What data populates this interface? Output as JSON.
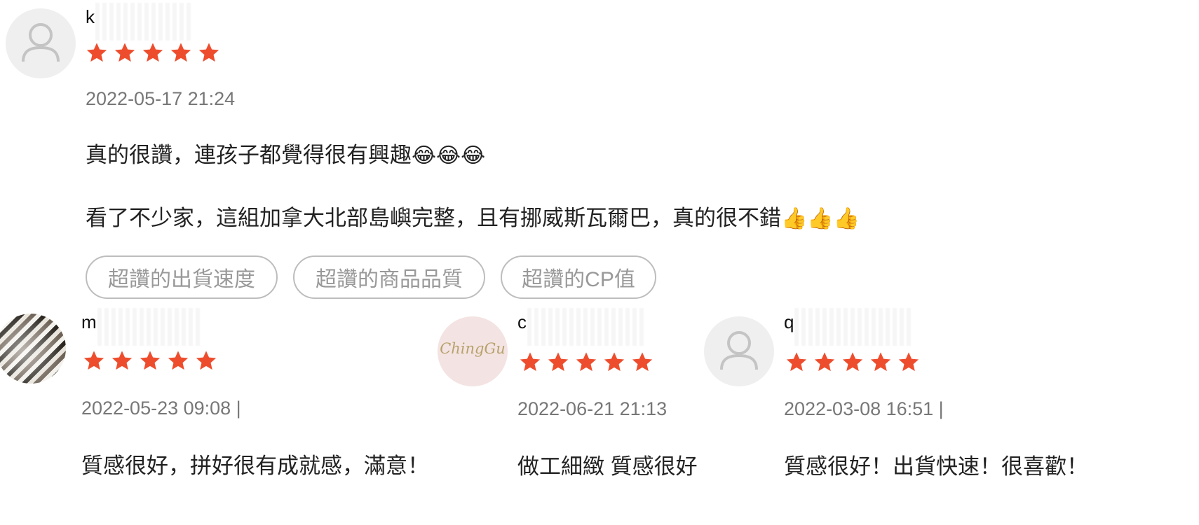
{
  "colors": {
    "star": "#EE4D2D",
    "timestamp": "#777777",
    "tag_border": "#BDBDBD",
    "tag_text": "#999999",
    "avatar_bg": "#EFEFEF"
  },
  "reviews": [
    {
      "username_visible": "k",
      "avatar_icon": "user-placeholder-icon",
      "rating": 5,
      "timestamp": "2022-05-17 21:24",
      "comment_line1": "真的很讚，連孩子都覺得很有興趣",
      "comment_line1_emoji": "😂😂😂",
      "comment_line2": "看了不少家，這組加拿大北部島嶼完整，且有挪威斯瓦爾巴，真的很不錯",
      "comment_line2_emoji": "👍👍👍",
      "tags": [
        "超讚的出貨速度",
        "超讚的商品品質",
        "超讚的CP值"
      ]
    },
    {
      "username_visible": "m",
      "avatar_icon": "user-photo-avatar",
      "rating": 5,
      "timestamp": "2022-05-23 09:08 |",
      "comment": "質感很好，拼好很有成就感，滿意！"
    },
    {
      "username_visible": "c",
      "avatar_icon": "brand-logo-avatar",
      "avatar_text": "ChingGu",
      "rating": 5,
      "timestamp": "2022-06-21 21:13",
      "comment": "做工細緻 質感很好"
    },
    {
      "username_visible": "q",
      "avatar_icon": "user-placeholder-icon",
      "rating": 5,
      "timestamp": "2022-03-08 16:51 |",
      "comment": "質感很好！出貨快速！很喜歡！"
    }
  ]
}
